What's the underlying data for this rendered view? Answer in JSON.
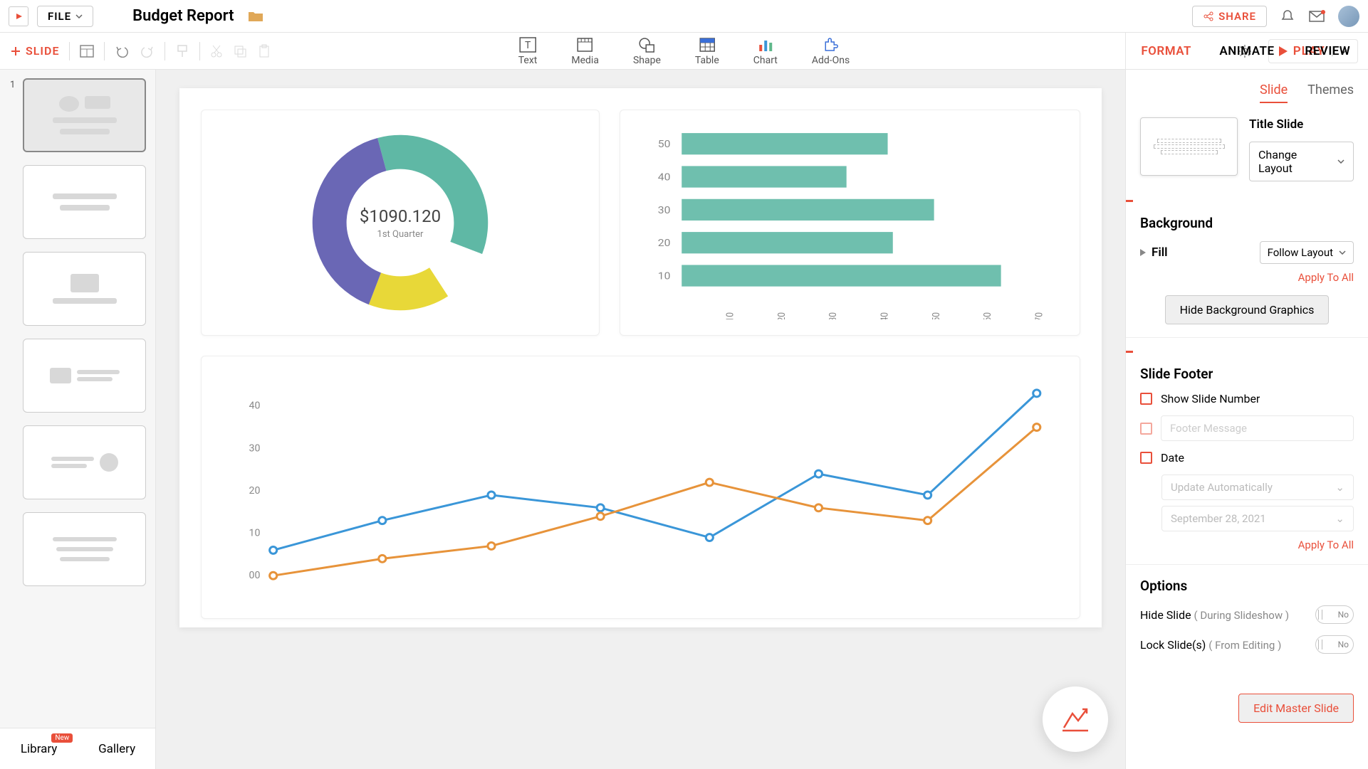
{
  "header": {
    "file_label": "FILE",
    "doc_title": "Budget Report",
    "share_label": "SHARE"
  },
  "toolbar": {
    "slide_label": "SLIDE",
    "insert": [
      {
        "label": "Text"
      },
      {
        "label": "Media"
      },
      {
        "label": "Shape"
      },
      {
        "label": "Table"
      },
      {
        "label": "Chart"
      },
      {
        "label": "Add-Ons"
      }
    ],
    "play_label": "PLAY"
  },
  "panel_tabs": [
    "FORMAT",
    "ANIMATE",
    "REVIEW"
  ],
  "slides_bottom": {
    "library": "Library",
    "gallery": "Gallery",
    "badge": "New"
  },
  "format": {
    "subtabs": [
      "Slide",
      "Themes"
    ],
    "layout_title": "Title Slide",
    "change_layout": "Change Layout",
    "background_title": "Background",
    "fill_label": "Fill",
    "fill_value": "Follow Layout",
    "apply_all": "Apply To All",
    "hide_bg": "Hide Background Graphics",
    "footer_title": "Slide Footer",
    "show_number": "Show Slide Number",
    "footer_msg_ph": "Footer Message",
    "date_label": "Date",
    "date_mode": "Update Automatically",
    "date_value": "September 28, 2021",
    "options_title": "Options",
    "hide_slide": "Hide Slide",
    "hide_slide_sub": "( During Slideshow )",
    "lock_slides": "Lock Slide(s)",
    "lock_slides_sub": "( From Editing )",
    "toggle_no": "No",
    "edit_master": "Edit Master Slide"
  },
  "chart_data": [
    {
      "type": "pie",
      "title": "",
      "center_value": "$1090.120",
      "center_label": "1st Quarter",
      "series": [
        {
          "name": "teal",
          "value": 35,
          "color": "#5fb8a5"
        },
        {
          "name": "gap",
          "value": 10,
          "color": "#ffffff"
        },
        {
          "name": "yellow",
          "value": 15,
          "color": "#e8d838"
        },
        {
          "name": "purple",
          "value": 40,
          "color": "#6a67b5"
        }
      ]
    },
    {
      "type": "bar",
      "orientation": "horizontal",
      "categories": [
        "50",
        "40",
        "30",
        "20",
        "10"
      ],
      "values": [
        40,
        32,
        49,
        41,
        62
      ],
      "x_ticks": [
        "10",
        "20",
        "30",
        "40",
        "50",
        "60",
        "70"
      ],
      "xlim": [
        0,
        70
      ],
      "color": "#6fbfae"
    },
    {
      "type": "line",
      "x": [
        0,
        1,
        2,
        3,
        4,
        5,
        6,
        7
      ],
      "y_ticks": [
        "00",
        "10",
        "20",
        "30",
        "40"
      ],
      "ylim": [
        0,
        45
      ],
      "series": [
        {
          "name": "blue",
          "color": "#3a96d8",
          "values": [
            6,
            13,
            19,
            16,
            9,
            24,
            19,
            43
          ]
        },
        {
          "name": "orange",
          "color": "#e7933a",
          "values": [
            0,
            4,
            7,
            14,
            22,
            16,
            13,
            35
          ]
        }
      ]
    }
  ]
}
